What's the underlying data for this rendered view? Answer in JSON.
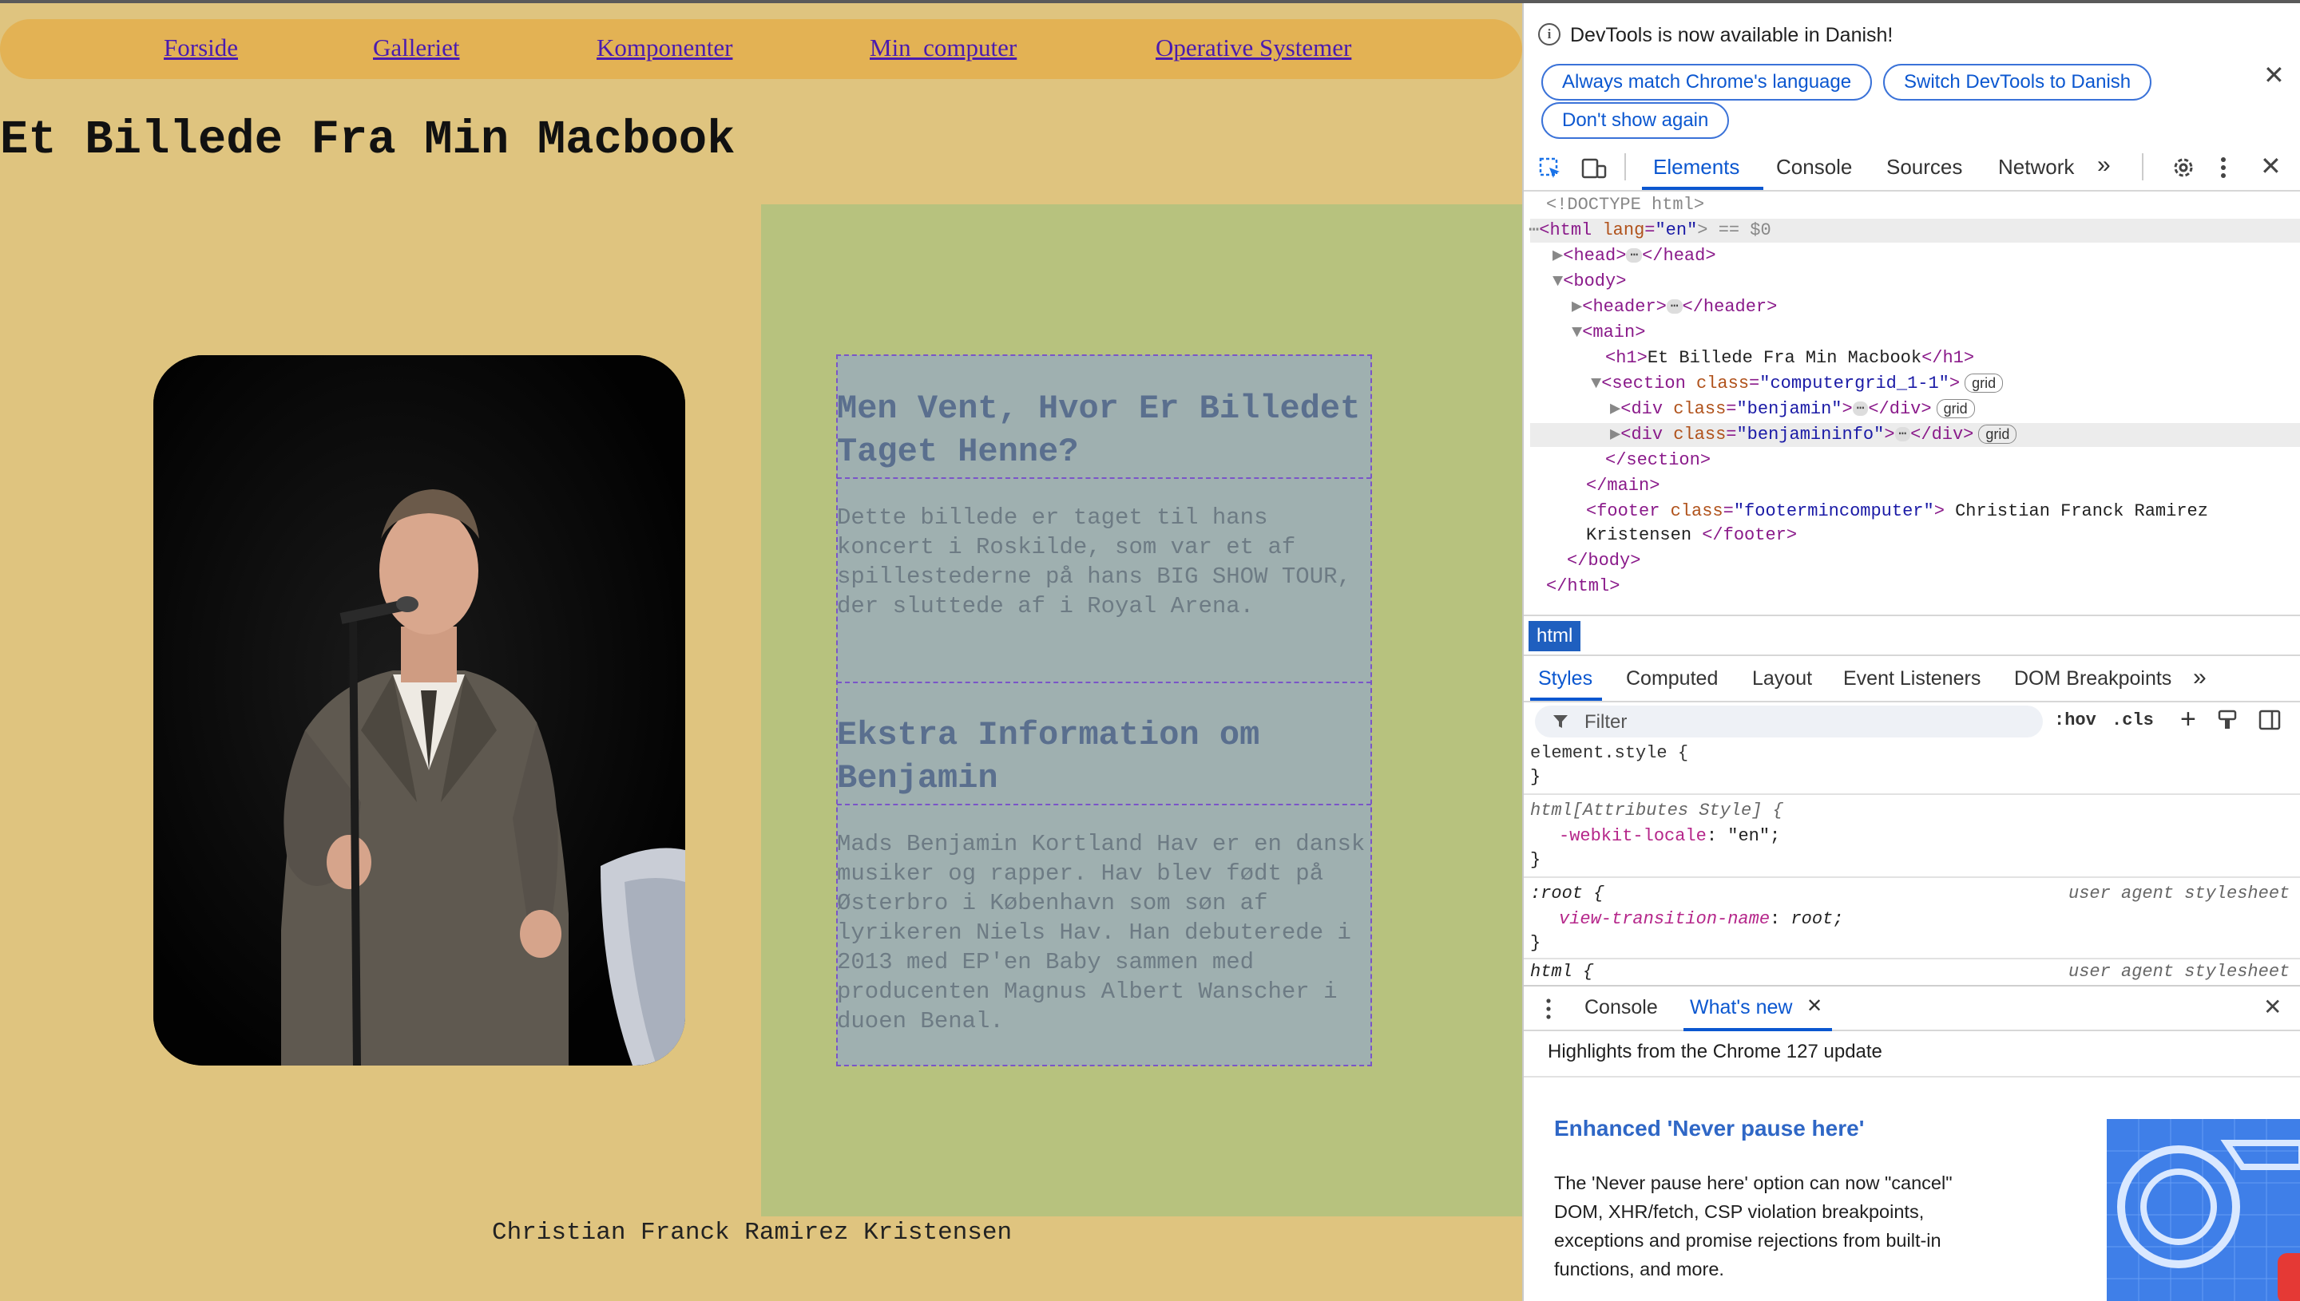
{
  "page": {
    "nav": [
      "Forside",
      "Galleriet",
      "Komponenter",
      "Min_computer",
      "Operative Systemer"
    ],
    "title": "Et Billede Fra Min Macbook",
    "heading1": "Men Vent, Hvor Er Billedet Taget Henne?",
    "para1": "Dette billede er taget til hans koncert i Roskilde, som var et af spillestederne på hans BIG SHOW TOUR, der sluttede af i Royal Arena.",
    "heading2": "Ekstra Information om Benjamin",
    "para2": "Mads Benjamin Kortland Hav er en dansk musiker og rapper. Hav blev født på Østerbro i København som søn af lyrikeren Niels Hav. Han debuterede i 2013 med EP'en Baby sammen med producenten Magnus Albert Wanscher i duoen Benal.",
    "footer": "Christian Franck Ramirez Kristensen"
  },
  "devtools": {
    "infobar": {
      "message": "DevTools is now available in Danish!",
      "btn_match": "Always match Chrome's language",
      "btn_switch": "Switch DevTools to Danish",
      "btn_dont": "Don't show again"
    },
    "tabs": [
      "Elements",
      "Console",
      "Sources",
      "Network"
    ],
    "dom": {
      "doctype": "<!DOCTYPE html>",
      "html_open": "<html",
      "lang_attr": "lang",
      "lang_val": "\"en\"",
      "html_tail": "> == $0",
      "head": "<head>",
      "head_close": "</head>",
      "body": "<body>",
      "header": "<header>",
      "header_close": "</header>",
      "main": "<main>",
      "h1_open": "<h1>",
      "h1_text": "Et Billede Fra Min Macbook",
      "h1_close": "</h1>",
      "section_open": "<section",
      "class_attr": "class",
      "section_class": "\"computergrid_1-1\"",
      "div_open": "<div",
      "div1_class": "\"benjamin\"",
      "div2_class": "\"benjamininfo\"",
      "div_close": "</div>",
      "section_close": "</section>",
      "main_close": "</main>",
      "footer_open": "<footer",
      "footer_class": "\"footermincomputer\"",
      "footer_text1": "Christian Franck Ramirez",
      "footer_text2": "Kristensen",
      "footer_close": "</footer>",
      "body_close": "</body>",
      "html_close": "</html>",
      "grid_badge": "grid"
    },
    "breadcrumb": "html",
    "style_tabs": [
      "Styles",
      "Computed",
      "Layout",
      "Event Listeners",
      "DOM Breakpoints"
    ],
    "filter_placeholder": "Filter",
    "hov": ":hov",
    "cls": ".cls",
    "styles": {
      "element_style": "element.style {",
      "close_brace": "}",
      "attr_selector": "html[Attributes Style] {",
      "locale_prop": "-webkit-locale",
      "locale_val": "\"en\";",
      "root_selector": ":root {",
      "ua_label": "user agent stylesheet",
      "vt_prop": "view-transition-name",
      "vt_val": "root;",
      "html_selector": "html {"
    },
    "drawer": {
      "tab_console": "Console",
      "tab_whatsnew": "What's new",
      "highlights": "Highlights from the Chrome 127 update",
      "feature_title": "Enhanced 'Never pause here'",
      "feature_text": "The 'Never pause here' option can now \"cancel\" DOM, XHR/fetch, CSP violation breakpoints, exceptions and promise rejections from built-in functions, and more."
    }
  }
}
